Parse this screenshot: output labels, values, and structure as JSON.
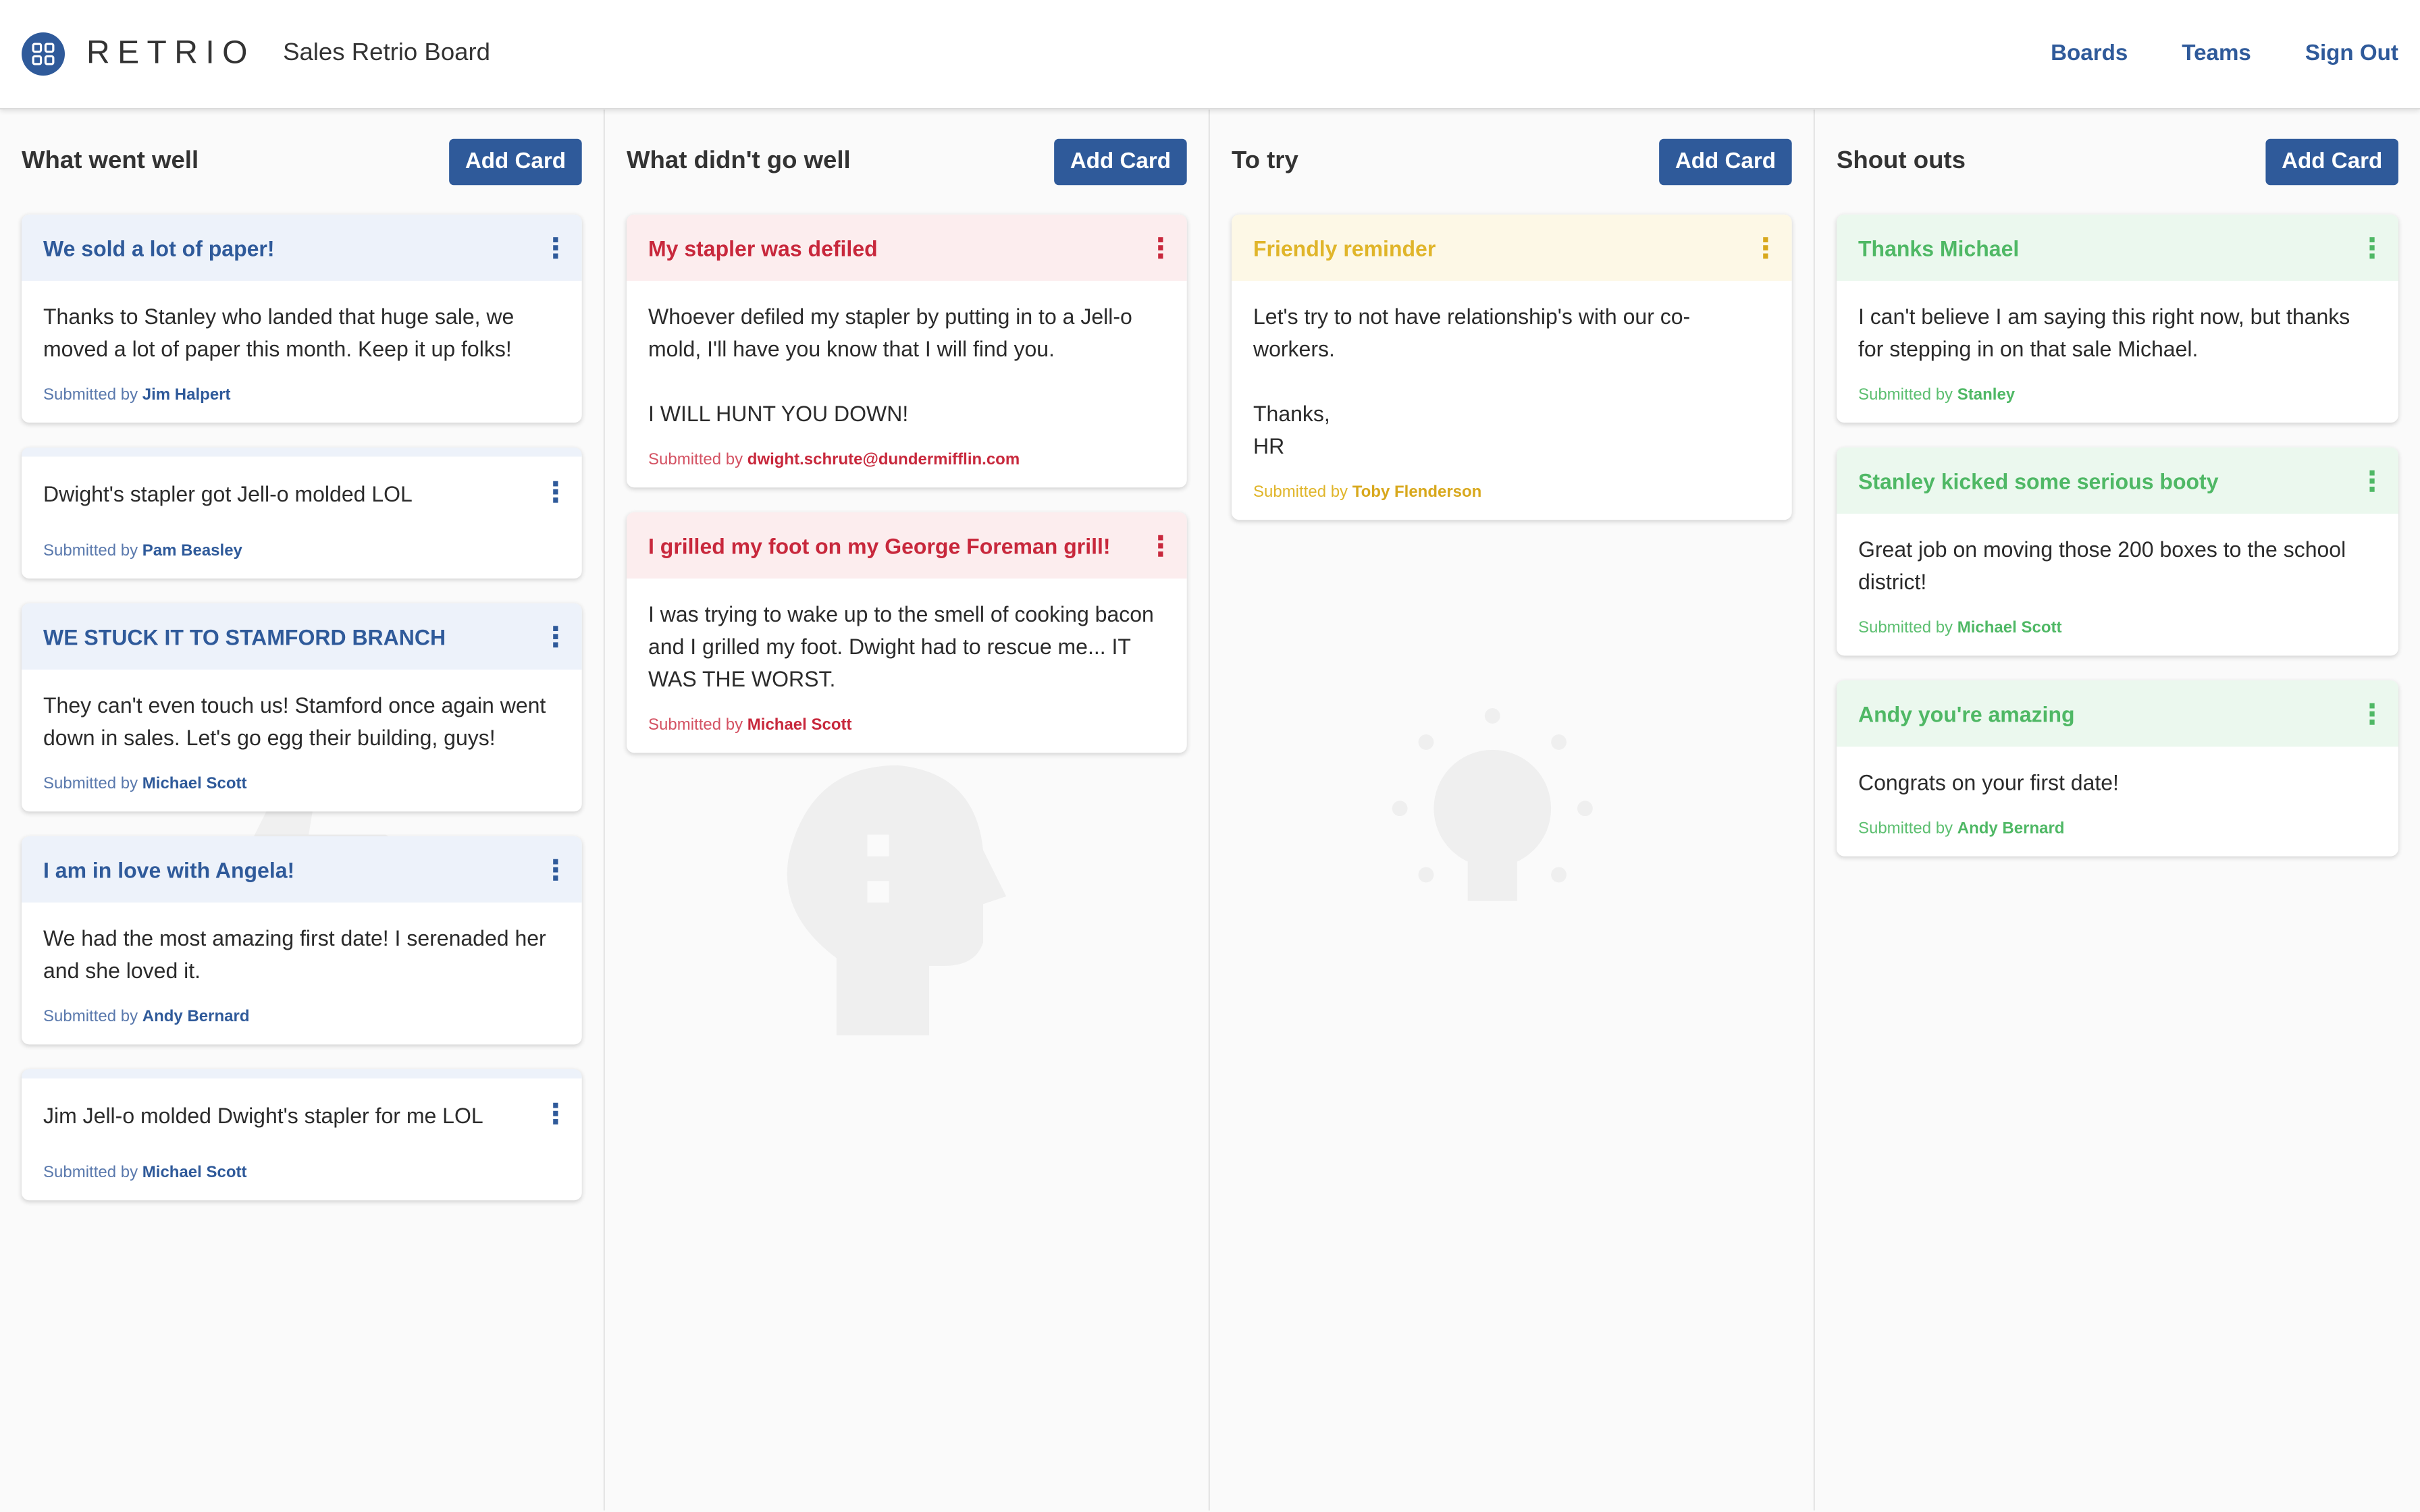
{
  "app": {
    "brand": "RETRIO",
    "board_title": "Sales Retrio Board",
    "logo_icon": "grid-icon"
  },
  "nav": {
    "boards": "Boards",
    "teams": "Teams",
    "sign_out": "Sign Out"
  },
  "colors": {
    "primary": "#2f5a9a",
    "went_well": "#2f5a9a",
    "didnt_go_well": "#c8283c",
    "to_try": "#e0b52a",
    "shout_outs": "#4fb865"
  },
  "submitted_by_prefix": "Submitted by",
  "columns": [
    {
      "title": "What went well",
      "add_label": "Add Card",
      "cards": [
        {
          "title": "We sold a lot of paper!",
          "body": "Thanks to Stanley who landed that huge sale, we moved a lot of paper this month. Keep it up folks!",
          "author": "Jim Halpert"
        },
        {
          "title": "",
          "body": "Dwight's stapler got Jell-o molded LOL",
          "author": "Pam Beasley"
        },
        {
          "title": "WE STUCK IT TO STAMFORD BRANCH",
          "body": "They can't even touch us! Stamford once again went down in sales. Let's go egg their building, guys!",
          "author": "Michael Scott"
        },
        {
          "title": "I am in love with Angela!",
          "body": "We had the most amazing first date! I serenaded her and she loved it.",
          "author": "Andy Bernard"
        },
        {
          "title": "",
          "body": "Jim Jell-o molded Dwight's stapler for me LOL",
          "author": "Michael Scott"
        }
      ]
    },
    {
      "title": "What didn't go well",
      "add_label": "Add Card",
      "cards": [
        {
          "title": "My stapler was defiled",
          "body": "Whoever defiled my stapler by putting in to a Jell-o mold, I'll have you know that I will find you.\n\nI WILL HUNT YOU DOWN!",
          "author": "dwight.schrute@dundermifflin.com"
        },
        {
          "title": "I grilled my foot on my George Foreman grill!",
          "body": "I was trying to wake up to the smell of cooking bacon and I grilled my foot. Dwight had to rescue me... IT WAS THE WORST.",
          "author": "Michael Scott"
        }
      ]
    },
    {
      "title": "To try",
      "add_label": "Add Card",
      "cards": [
        {
          "title": "Friendly reminder",
          "body": "Let's try to not have relationship's with our co-workers.\n\nThanks,\nHR",
          "author": "Toby Flenderson"
        }
      ]
    },
    {
      "title": "Shout outs",
      "add_label": "Add Card",
      "cards": [
        {
          "title": "Thanks Michael",
          "body": "I can't believe I am saying this right now, but thanks for stepping in on that sale Michael.",
          "author": "Stanley"
        },
        {
          "title": "Stanley kicked some serious booty",
          "body": "Great job on moving those 200 boxes to the school district!",
          "author": "Michael Scott"
        },
        {
          "title": "Andy you're amazing",
          "body": "Congrats on your first date!",
          "author": "Andy Bernard"
        }
      ]
    }
  ]
}
